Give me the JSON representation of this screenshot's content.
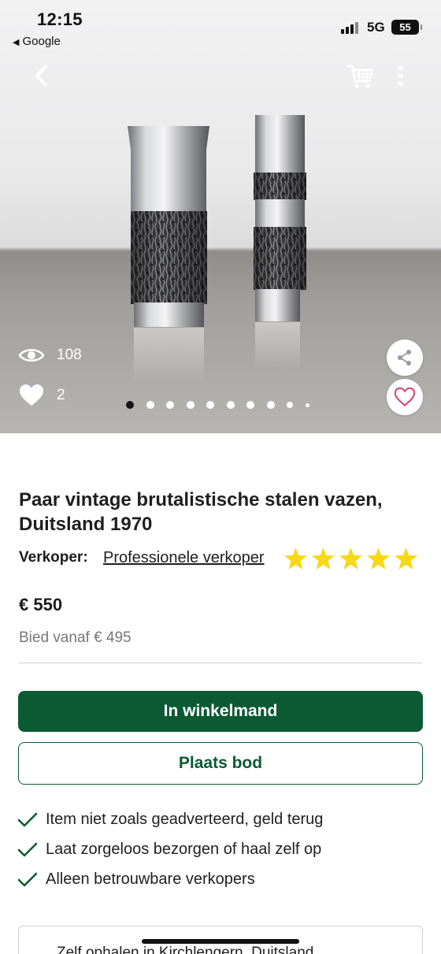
{
  "status_bar": {
    "time": "12:15",
    "back_app": "Google",
    "network": "5G",
    "battery": "55"
  },
  "hero": {
    "views": "108",
    "likes": "2",
    "image_count": 10,
    "active_image": 1
  },
  "product": {
    "title": "Paar vintage brutalistische stalen vazen, Duitsland 1970",
    "seller_label": "Verkoper:",
    "seller_link": "Professionele verkoper",
    "rating_stars": 5,
    "price": "€ 550",
    "bid_from": "Bied vanaf € 495"
  },
  "actions": {
    "add_to_cart": "In winkelmand",
    "place_bid": "Plaats bod"
  },
  "usps": [
    "Item niet zoals geadverteerd, geld terug",
    "Laat zorgeloos bezorgen of haal zelf op",
    "Alleen betrouwbare verkopers"
  ],
  "delivery": {
    "text": "Zelf ophalen in Kirchlengern, Duitsland"
  },
  "colors": {
    "brand_green": "#0c5a33",
    "star_yellow": "#f7d816",
    "heart_pink": "#d6437a"
  }
}
